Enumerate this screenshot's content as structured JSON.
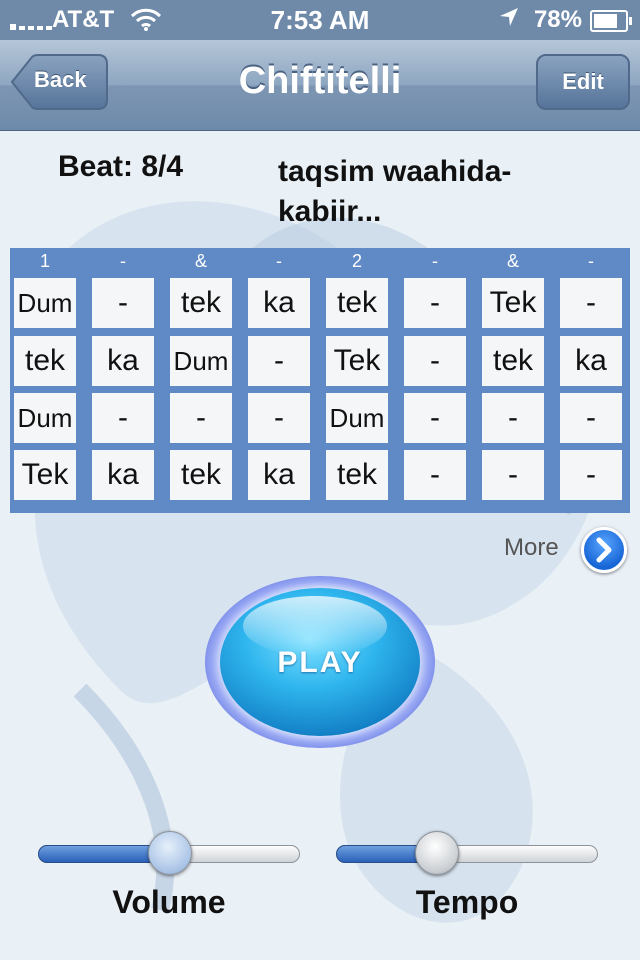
{
  "status_bar": {
    "carrier": "AT&T",
    "time": "7:53 AM",
    "battery": "78%",
    "battery_level": 0.78
  },
  "nav": {
    "title": "Chiftitelli",
    "back_label": "Back",
    "edit_label": "Edit"
  },
  "rhythm": {
    "beat": "Beat: 8/4",
    "description": "taqsim waahida-kabiir..."
  },
  "grid": {
    "header": [
      "1",
      "-",
      "&",
      "-",
      "2",
      "-",
      "&",
      "-"
    ],
    "rows": [
      [
        "Dum",
        "-",
        "tek",
        "ka",
        "tek",
        "-",
        "Tek",
        "-"
      ],
      [
        "tek",
        "ka",
        "Dum",
        "-",
        "Tek",
        "-",
        "tek",
        "ka"
      ],
      [
        "Dum",
        "-",
        "-",
        "-",
        "Dum",
        "-",
        "-",
        "-"
      ],
      [
        "Tek",
        "ka",
        "tek",
        "ka",
        "tek",
        "-",
        "-",
        "-"
      ]
    ]
  },
  "more": {
    "label": "More"
  },
  "play": {
    "label": "PLAY"
  },
  "volume": {
    "label": "Volume",
    "level": 0.5
  },
  "tempo": {
    "label": "Tempo",
    "level": 0.36
  },
  "colors": {
    "grid_bg": "#5f8ac6",
    "nav_bg": "#7d96b3",
    "play_blue": "#2fb6ee"
  }
}
